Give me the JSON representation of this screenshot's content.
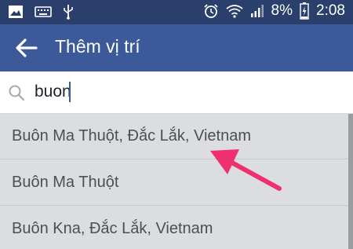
{
  "status_bar": {
    "icons": [
      "image-icon",
      "keyboard-icon",
      "usb-icon",
      "alarm-icon",
      "wifi-icon",
      "signal-icon",
      "battery-charging-icon"
    ],
    "battery": "8%",
    "time": "2:08"
  },
  "app_bar": {
    "back_icon": "back-arrow-icon",
    "title": "Thêm vị trí",
    "color": "#3c5a99"
  },
  "search": {
    "icon": "search-icon",
    "value": "buon"
  },
  "results": [
    {
      "label": "Buôn Ma Thuột, Đắc Lắk, Vietnam"
    },
    {
      "label": "Buôn Ma Thuột"
    },
    {
      "label": "Buôn Kna, Đắc Lắk, Vietnam"
    }
  ],
  "annotation": {
    "type": "arrow",
    "color": "#f0306e"
  }
}
